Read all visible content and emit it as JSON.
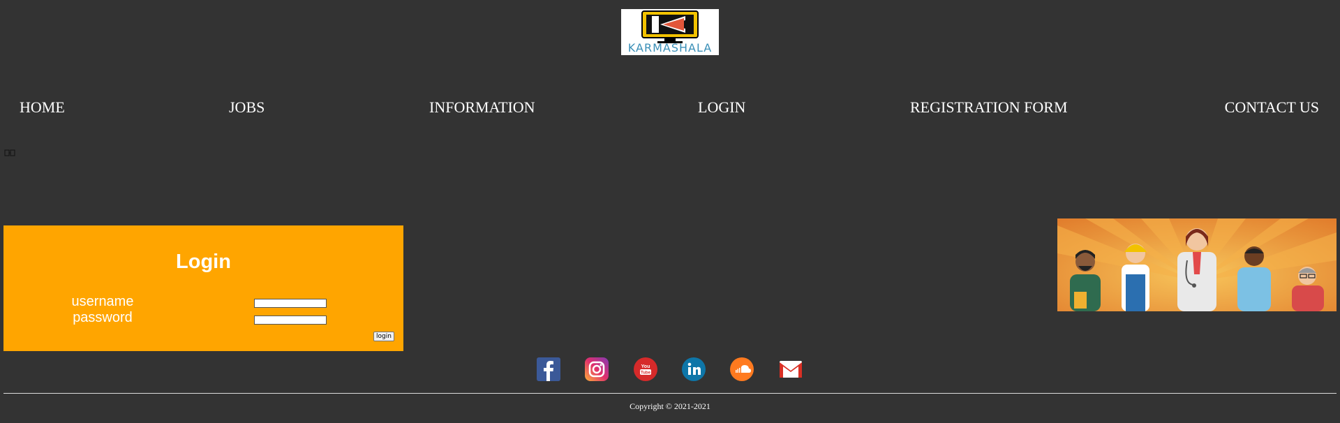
{
  "logo": {
    "text": "KARMASHALA",
    "letter": "K"
  },
  "nav": {
    "items": [
      {
        "label": "HOME"
      },
      {
        "label": "JOBS"
      },
      {
        "label": "INFORMATION"
      },
      {
        "label": "LOGIN"
      },
      {
        "label": "REGISTRATION FORM"
      },
      {
        "label": "CONTACT US"
      }
    ]
  },
  "login": {
    "title": "Login",
    "username_label": "username",
    "password_label": "password",
    "username_value": "",
    "password_value": "",
    "button_label": "login"
  },
  "social": {
    "icons": [
      "facebook-icon",
      "instagram-icon",
      "youtube-icon",
      "linkedin-icon",
      "soundcloud-icon",
      "gmail-icon"
    ]
  },
  "footer": {
    "copyright": "Copyright © 2021-2021"
  },
  "colors": {
    "background": "#333333",
    "login_panel": "#ffa500",
    "text": "#ffffff"
  }
}
